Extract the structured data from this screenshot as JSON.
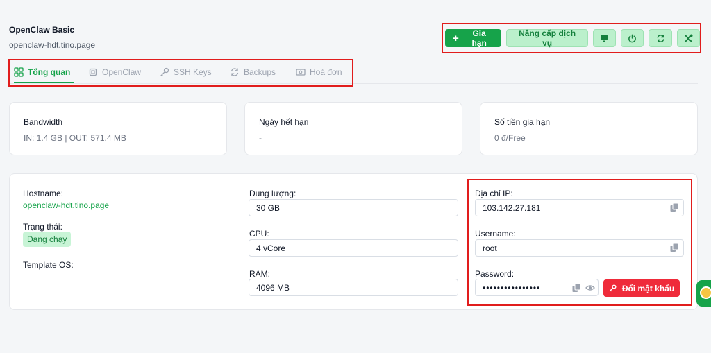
{
  "header": {
    "title": "OpenClaw Basic",
    "subtitle": "openclaw-hdt.tino.page"
  },
  "actions": {
    "renew_label": "Gia hạn",
    "upgrade_label": "Nâng cấp dịch vụ",
    "icons": [
      "monitor-icon",
      "power-icon",
      "refresh-icon",
      "tools-icon"
    ]
  },
  "tabs": [
    {
      "label": "Tổng quan",
      "icon": "grid-icon",
      "active": true
    },
    {
      "label": "OpenClaw",
      "icon": "chip-icon"
    },
    {
      "label": "SSH Keys",
      "icon": "key-icon"
    },
    {
      "label": "Backups",
      "icon": "refresh-icon"
    },
    {
      "label": "Hoá đơn",
      "icon": "invoice-icon"
    }
  ],
  "stats": {
    "bandwidth": {
      "label": "Bandwidth",
      "value": "IN: 1.4 GB | OUT: 571.4 MB"
    },
    "expiry": {
      "label": "Ngày hết hạn",
      "value": "-"
    },
    "renewal": {
      "label": "Số tiền gia hạn",
      "value": "0 đ/Free"
    }
  },
  "details": {
    "hostname_label": "Hostname:",
    "hostname_value": "openclaw-hdt.tino.page",
    "status_label": "Trạng thái:",
    "status_value": "Đang chạy",
    "template_label": "Template OS:",
    "storage_label": "Dung lượng:",
    "storage_value": "30 GB",
    "cpu_label": "CPU:",
    "cpu_value": "4 vCore",
    "ram_label": "RAM:",
    "ram_value": "4096 MB"
  },
  "credentials": {
    "ip_label": "Địa chỉ IP:",
    "ip_value": "103.142.27.181",
    "username_label": "Username:",
    "username_value": "root",
    "password_label": "Password:",
    "password_value": "••••••••••••••••",
    "change_password_label": "Đổi mật khẩu"
  },
  "colors": {
    "accent": "#16a34a",
    "danger": "#ef2b3a",
    "highlight": "#e11d1d"
  }
}
